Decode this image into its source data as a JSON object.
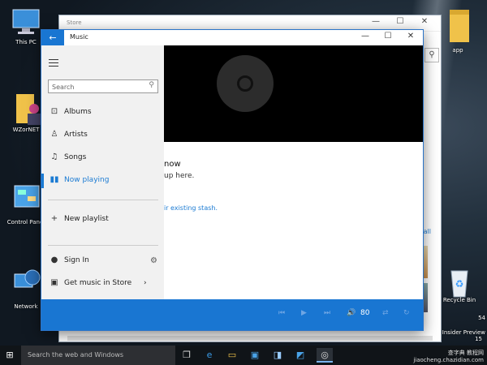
{
  "desktop": {
    "icons_left": [
      {
        "label": "This PC",
        "icon": "computer-icon"
      },
      {
        "label": "WZorNET",
        "icon": "user-folder-icon"
      },
      {
        "label": "Control Panel",
        "icon": "control-panel-icon"
      },
      {
        "label": "Network",
        "icon": "network-icon"
      }
    ],
    "icons_right": [
      {
        "label": "app",
        "icon": "folder-icon"
      },
      {
        "label": "Recycle Bin",
        "icon": "recycle-bin-icon"
      }
    ],
    "insider_text": "e Insider Preview",
    "build_frag_1": "54",
    "build_frag_2": "15"
  },
  "store_window": {
    "title": "Store",
    "all_link": "all"
  },
  "music_window": {
    "title": "Music",
    "back_label": "←",
    "search_placeholder": "Search",
    "nav": [
      {
        "label": "Albums",
        "icon": "album-icon"
      },
      {
        "label": "Artists",
        "icon": "artist-icon"
      },
      {
        "label": "Songs",
        "icon": "song-icon"
      },
      {
        "label": "Now playing",
        "icon": "now-playing-icon",
        "active": true
      }
    ],
    "new_playlist": "New playlist",
    "sign_in": "Sign In",
    "get_music": "Get music in Store",
    "content_heading": "now",
    "content_sub": "up here.",
    "content_link": "ir existing stash.",
    "player": {
      "volume": "80"
    }
  },
  "taskbar": {
    "search_placeholder": "Search the web and Windows"
  },
  "watermark": {
    "line1": "查字典 教程网",
    "line2": "jiaocheng.chazidian.com"
  },
  "colors": {
    "accent": "#1976d2",
    "link": "#1b7bd3",
    "sidebar_bg": "#f1f1f1"
  }
}
